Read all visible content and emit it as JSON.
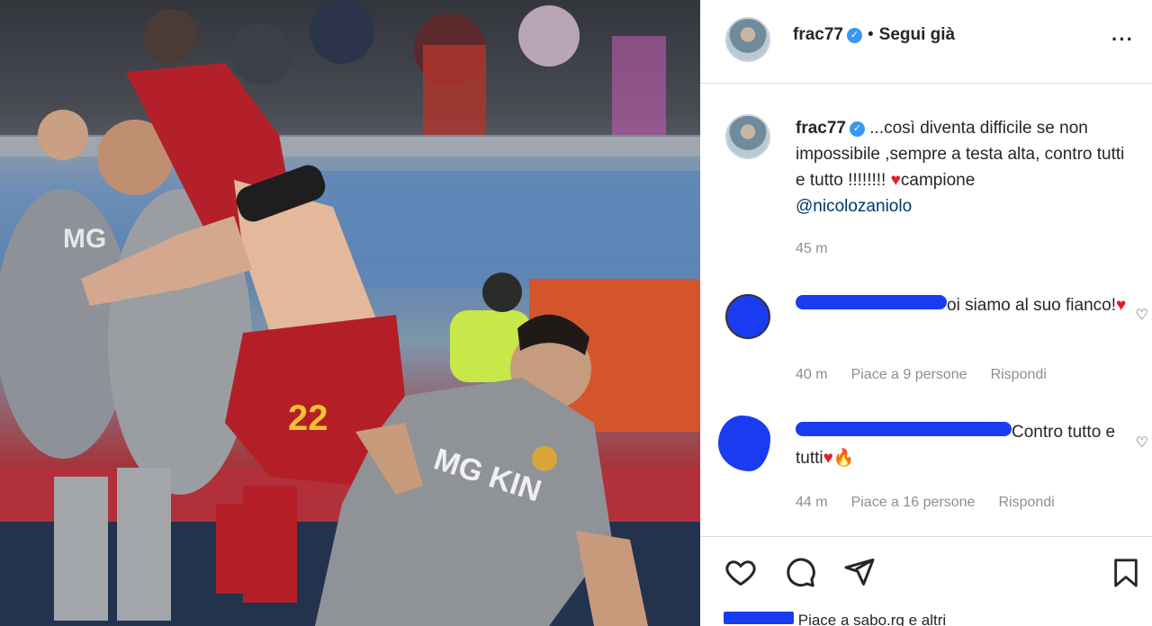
{
  "post": {
    "username": "frac77",
    "verified_mark": "✓",
    "separator": "•",
    "follow_label": "Segui già",
    "more_label": "···"
  },
  "caption": {
    "username": "frac77",
    "text": " ...così diventa difficile se non impossibile ,sempre a testa alta, contro tutti e tutto !!!!!!!! ",
    "heart": "♥",
    "text_after_heart": "campione",
    "mention": "@nicolozaniolo",
    "time": "45 m"
  },
  "comments": [
    {
      "text_visible": "oi siamo al suo fianco!",
      "heart": "♥",
      "time": "40 m",
      "likes": "Piace a 9 persone",
      "reply": "Rispondi"
    },
    {
      "text_visible": "Contro tutto e tutti",
      "heart": "♥",
      "fire": "🔥",
      "time": "44 m",
      "likes": "Piace a 16 persone",
      "reply": "Rispondi"
    }
  ],
  "footer": {
    "likes_text": "Piace a sabo.rg e altri"
  },
  "photo": {
    "jersey_number": "22",
    "sponsor_text": "MG KIN",
    "sponsor_text_2": "MG"
  },
  "icons": [
    "heart-icon",
    "comment-icon",
    "share-icon",
    "bookmark-icon",
    "more-icon",
    "verified-icon"
  ],
  "colors": {
    "verified": "#3897f0",
    "scribble": "#1a3cf0",
    "heart": "#e0202a",
    "meta": "#8e8e8e"
  }
}
